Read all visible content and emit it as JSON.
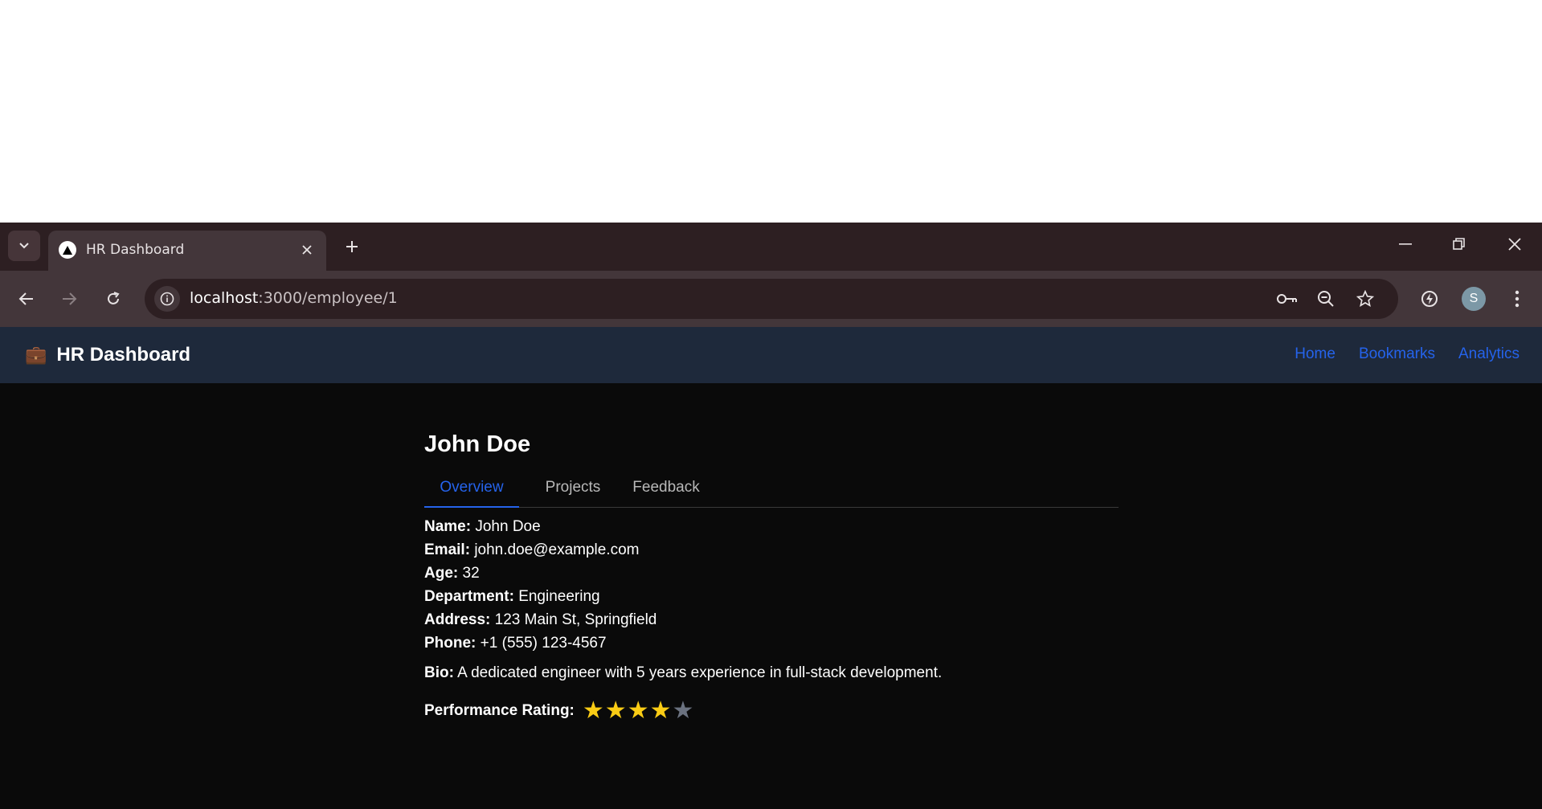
{
  "browser": {
    "tab_title": "HR Dashboard",
    "url_host": "localhost",
    "url_path": ":3000/employee/1",
    "profile_initial": "S"
  },
  "navbar": {
    "brand_icon": "💼",
    "brand_title": "HR Dashboard",
    "links": [
      "Home",
      "Bookmarks",
      "Analytics"
    ]
  },
  "employee": {
    "name": "John Doe",
    "tabs": [
      "Overview",
      "Projects",
      "Feedback"
    ],
    "active_tab": "Overview",
    "fields": [
      {
        "label": "Name:",
        "value": "John Doe"
      },
      {
        "label": "Email:",
        "value": "john.doe@example.com"
      },
      {
        "label": "Age:",
        "value": "32"
      },
      {
        "label": "Department:",
        "value": "Engineering"
      },
      {
        "label": "Address:",
        "value": "123 Main St, Springfield"
      },
      {
        "label": "Phone:",
        "value": "+1 (555) 123-4567"
      }
    ],
    "bio_label": "Bio:",
    "bio": "A dedicated engineer with 5 years experience in full-stack development.",
    "rating_label": "Performance Rating:",
    "rating": 4,
    "rating_max": 5
  },
  "colors": {
    "accent": "#2563eb",
    "star_on": "#facc15",
    "star_off": "#6b7280",
    "navbar_bg": "#1e293b",
    "page_bg": "#0a0a0a"
  },
  "icons": [
    "tab-search-icon",
    "favicon-icon",
    "close-icon",
    "plus-icon",
    "minimize-icon",
    "restore-icon",
    "window-close-icon",
    "back-icon",
    "forward-icon",
    "reload-icon",
    "info-icon",
    "key-icon",
    "zoom-icon",
    "star-icon",
    "extension-icon",
    "menu-icon"
  ]
}
